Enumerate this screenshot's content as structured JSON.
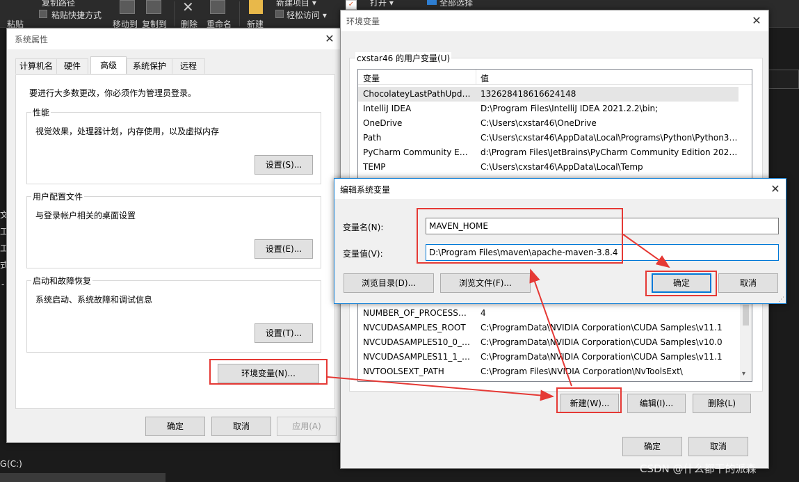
{
  "explorer": {
    "ribbon": {
      "copy_path": "复制路径",
      "paste": "粘贴",
      "paste_shortcut": "粘贴快捷方式",
      "move_to": "移动到",
      "copy_to": "复制到",
      "delete": "删除",
      "rename": "重命名",
      "new": "新建",
      "new_item": "新建项目 ▾",
      "easy_access": "轻松访问 ▾",
      "open": "打开 ▾",
      "select_all": "全部选择"
    },
    "side_fragments": [
      "文",
      "工",
      "工",
      "式",
      "-"
    ],
    "drive": "(C:)",
    "drive_glyph": "G"
  },
  "sysprops": {
    "title": "系统属性",
    "tabs": [
      "计算机名",
      "硬件",
      "高级",
      "系统保护",
      "远程"
    ],
    "active_tab_index": 2,
    "admin_note": "要进行大多数更改，你必须作为管理员登录。",
    "performance": {
      "title": "性能",
      "desc": "视觉效果，处理器计划，内存使用，以及虚拟内存",
      "button": "设置(S)..."
    },
    "profiles": {
      "title": "用户配置文件",
      "desc": "与登录帐户相关的桌面设置",
      "button": "设置(E)..."
    },
    "startup": {
      "title": "启动和故障恢复",
      "desc": "系统启动、系统故障和调试信息",
      "button": "设置(T)..."
    },
    "env_button": "环境变量(N)...",
    "ok": "确定",
    "cancel": "取消",
    "apply": "应用(A)"
  },
  "envvars": {
    "title": "环境变量",
    "user_section": "cxstar46 的用户变量(U)",
    "col_var": "变量",
    "col_val": "值",
    "user_vars": [
      {
        "name": "ChocolateyLastPathUpdate",
        "value": "132628418616624148"
      },
      {
        "name": "IntelliJ IDEA",
        "value": "D:\\Program Files\\IntelliJ IDEA 2021.2.2\\bin;"
      },
      {
        "name": "OneDrive",
        "value": "C:\\Users\\cxstar46\\OneDrive"
      },
      {
        "name": "Path",
        "value": "C:\\Users\\cxstar46\\AppData\\Local\\Programs\\Python\\Python37..."
      },
      {
        "name": "PyCharm Community Editi...",
        "value": "d:\\Program Files\\JetBrains\\PyCharm Community Edition 2020...."
      },
      {
        "name": "TEMP",
        "value": "C:\\Users\\cxstar46\\AppData\\Local\\Temp"
      }
    ],
    "system_vars": [
      {
        "name": "NUMBER_OF_PROCESSORS",
        "value": "4"
      },
      {
        "name": "NVCUDASAMPLES_ROOT",
        "value": "C:\\ProgramData\\NVIDIA Corporation\\CUDA Samples\\v11.1"
      },
      {
        "name": "NVCUDASAMPLES10_0_R...",
        "value": "C:\\ProgramData\\NVIDIA Corporation\\CUDA Samples\\v10.0"
      },
      {
        "name": "NVCUDASAMPLES11_1_R...",
        "value": "C:\\ProgramData\\NVIDIA Corporation\\CUDA Samples\\v11.1"
      },
      {
        "name": "NVTOOLSEXT_PATH",
        "value": "C:\\Program Files\\NVIDIA Corporation\\NvToolsExt\\"
      }
    ],
    "new_button": "新建(W)...",
    "edit_button": "编辑(I)...",
    "delete_button": "删除(L)",
    "ok": "确定",
    "cancel": "取消"
  },
  "editvar": {
    "title": "编辑系统变量",
    "name_label": "变量名(N):",
    "value_label": "变量值(V):",
    "name_value": "MAVEN_HOME",
    "value_value": "D:\\Program Files\\maven\\apache-maven-3.8.4",
    "browse_dir": "浏览目录(D)...",
    "browse_file": "浏览文件(F)...",
    "ok": "确定",
    "cancel": "取消"
  },
  "watermark": "CSDN @什么都干的派森",
  "colors": {
    "highlight": "#e53935",
    "accent": "#0078d7"
  }
}
